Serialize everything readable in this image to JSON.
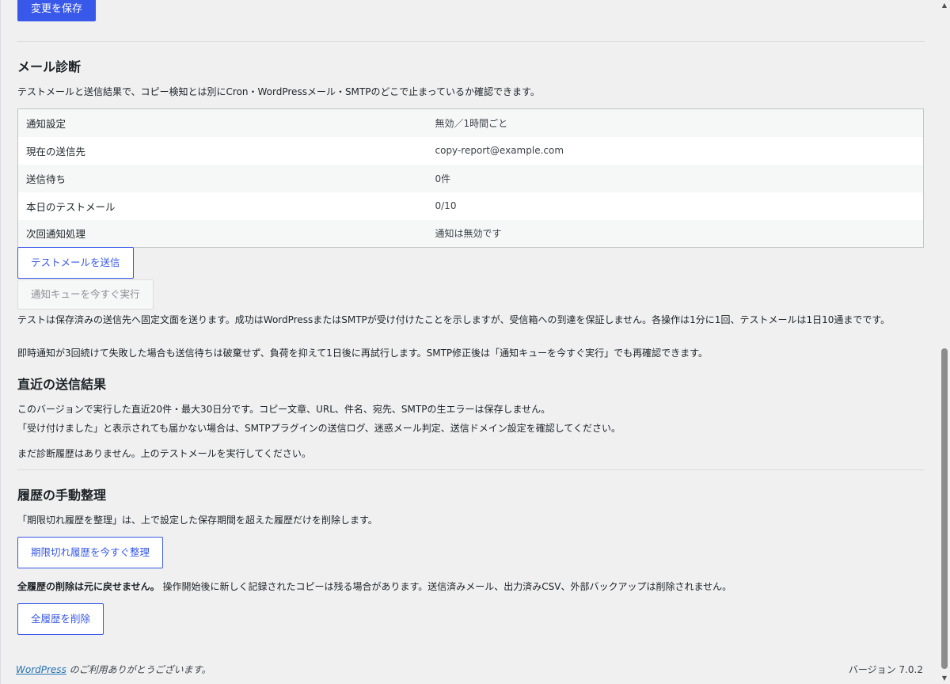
{
  "top_actions": {
    "save_label": "変更を保存"
  },
  "mail_diagnostics": {
    "title": "メール診断",
    "description": "テストメールと送信結果で、コピー検知とは別にCron・WordPressメール・SMTPのどこで止まっているか確認できます。",
    "rows": [
      {
        "label": "通知設定",
        "value": "無効／1時間ごと"
      },
      {
        "label": "現在の送信先",
        "value": "copy-report@example.com"
      },
      {
        "label": "送信待ち",
        "value": "0件"
      },
      {
        "label": "本日のテストメール",
        "value": "0/10"
      },
      {
        "label": "次回通知処理",
        "value": "通知は無効です"
      }
    ],
    "send_test_label": "テストメールを送信",
    "run_queue_label": "通知キューを今すぐ実行",
    "note_1": "テストは保存済みの送信先へ固定文面を送ります。成功はWordPressまたはSMTPが受け付けたことを示しますが、受信箱への到達を保証しません。各操作は1分に1回、テストメールは1日10通までです。",
    "note_2": "即時通知が3回続けて失敗した場合も送信待ちは破棄せず、負荷を抑えて1日後に再試行します。SMTP修正後は「通知キューを今すぐ実行」でも再確認できます。"
  },
  "recent_results": {
    "title": "直近の送信結果",
    "description_1": "このバージョンで実行した直近20件・最大30日分です。コピー文章、URL、件名、宛先、SMTPの生エラーは保存しません。",
    "description_2": "「受け付けました」と表示されても届かない場合は、SMTPプラグインの送信ログ、迷惑メール判定、送信ドメイン設定を確認してください。",
    "empty_message": "まだ診断履歴はありません。上のテストメールを実行してください。"
  },
  "history_cleanup": {
    "title": "履歴の手動整理",
    "description": "「期限切れ履歴を整理」は、上で設定した保存期間を超えた履歴だけを削除します。",
    "cleanup_label": "期限切れ履歴を今すぐ整理",
    "warning_strong": "全履歴の削除は元に戻せません。",
    "warning_rest": " 操作開始後に新しく記録されたコピーは残る場合があります。送信済みメール、出力済みCSV、外部バックアップは削除されません。",
    "delete_all_label": "全履歴を削除"
  },
  "footer": {
    "wordpress_link": "WordPress",
    "thanks_text": " のご利用ありがとうございます。",
    "version": "バージョン 7.0.2"
  }
}
